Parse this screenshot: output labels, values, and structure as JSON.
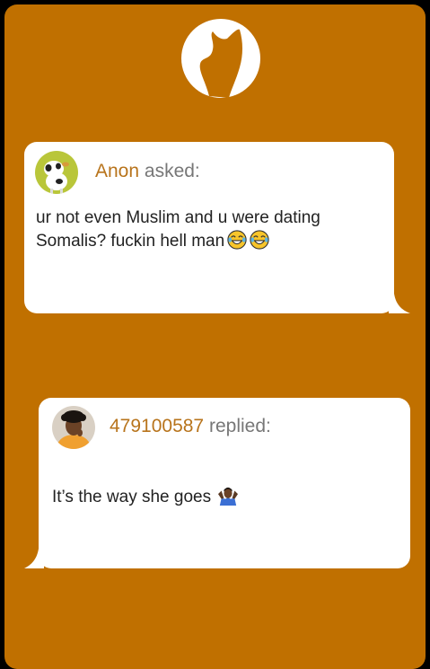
{
  "question": {
    "author": "Anon",
    "verb": "asked:",
    "text": "ur not even Muslim and u were dating Somalis? fuckin hell man"
  },
  "reply": {
    "author": "479100587",
    "verb": "replied:",
    "text": "It’s the way she goes"
  },
  "colors": {
    "background": "#c07000",
    "bubble": "#ffffff",
    "name": "#b8741c"
  },
  "icons": {
    "logo": "cat-head-logo",
    "question_emoji": "tears-of-joy-emoji",
    "reply_emoji": "shrug-emoji"
  }
}
